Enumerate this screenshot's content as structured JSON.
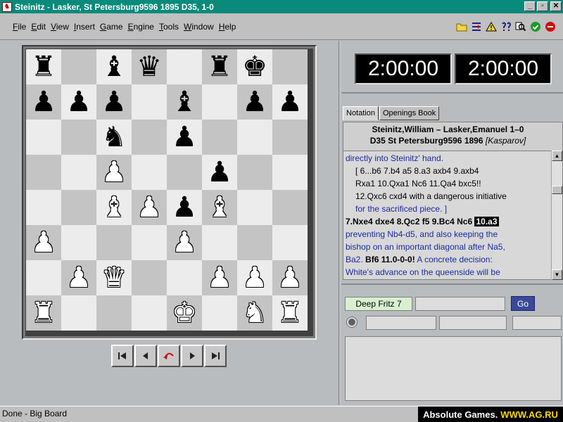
{
  "window": {
    "title": "Steinitz - Lasker, St Petersburg9596 1895  D35, 1-0",
    "min_label": "_",
    "max_label": "▫",
    "close_label": "✕"
  },
  "menu": [
    "File",
    "Edit",
    "View",
    "Insert",
    "Game",
    "Engine",
    "Tools",
    "Window",
    "Help"
  ],
  "toolbar": {
    "icons": [
      "folder-icon",
      "split-icon",
      "warning-icon",
      "hint-icon",
      "zoom-icon",
      "ok-icon",
      "stop-icon"
    ]
  },
  "board": {
    "rows": [
      [
        "bR",
        "",
        "bB",
        "bQ",
        "",
        "bR",
        "bK",
        ""
      ],
      [
        "bP",
        "bP",
        "bP",
        "",
        "bB",
        "",
        "bP",
        "bP"
      ],
      [
        "",
        "",
        "bN",
        "",
        "bP",
        "",
        "",
        ""
      ],
      [
        "",
        "",
        "wP",
        "",
        "",
        "bP",
        "",
        ""
      ],
      [
        "",
        "",
        "wB",
        "wP",
        "bP",
        "wB",
        "",
        ""
      ],
      [
        "wP",
        "",
        "",
        "",
        "wP",
        "",
        "",
        ""
      ],
      [
        "",
        "wP",
        "wQ",
        "",
        "",
        "wP",
        "wP",
        "wP"
      ],
      [
        "wR",
        "",
        "",
        "",
        "wK",
        "",
        "wN",
        "wR"
      ]
    ]
  },
  "clocks": {
    "white": "2:00:00",
    "black": "2:00:00"
  },
  "tabs": [
    "Notation",
    "Openings Book"
  ],
  "notation": {
    "header_players": "Steinitz,William – Lasker,Emanuel  1–0",
    "header_eco": "D35  St Petersburg9596 1896",
    "header_annotator": "[Kasparov]",
    "lines": [
      "directly into Steinitz' hand.",
      "[ 6...b6 7.b4  a5  8.a3  axb4  9.axb4",
      "Rxa1  10.Qxa1  Nc6  11.Qa4  bxc5!!",
      "12.Qxc6  cxd4 with a dangerous initiative",
      "for the sacrificed piece. ]",
      "7.Nxe4  dxe4  8.Qc2  f5  9.Bc4  Nc6",
      "10.a3",
      "preventing Nb4-d5, and also keeping the",
      "bishop on an important diagonal after Na5,",
      "Ba2.",
      "Bf6  11.0-0-0!",
      "A concrete decision:",
      "White's advance on the queenside will be"
    ]
  },
  "engine": {
    "name": "Deep Fritz 7",
    "go_label": "Go"
  },
  "status": {
    "text": "Done - Big Board"
  },
  "watermark": {
    "brand": "Absolute Games.",
    "url": "WWW.AG.RU"
  }
}
